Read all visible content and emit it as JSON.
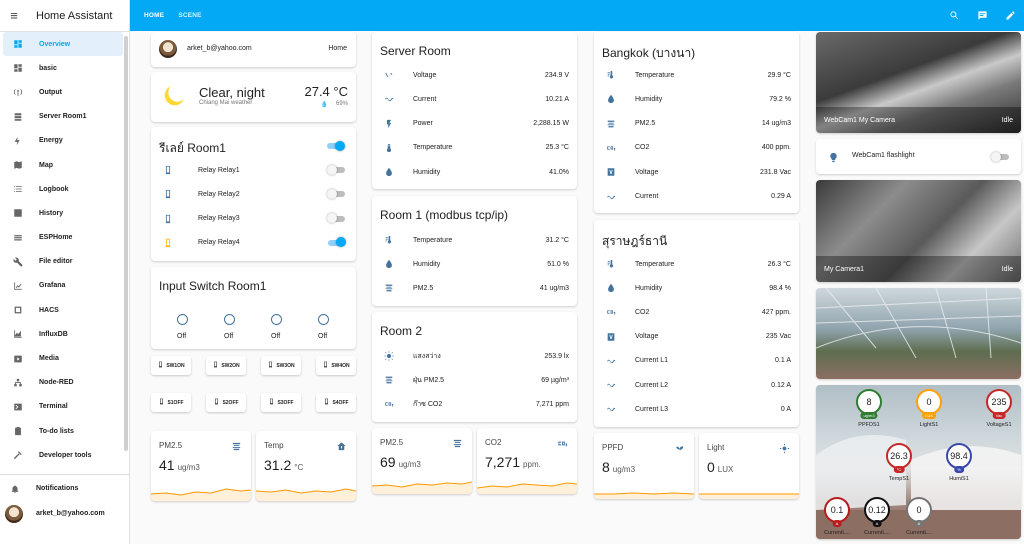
{
  "app": {
    "title": "Home Assistant"
  },
  "sidebar": {
    "items": [
      {
        "label": "Overview",
        "icon": "view-dashboard-icon",
        "active": true
      },
      {
        "label": "basic",
        "icon": "view-dashboard-icon"
      },
      {
        "label": "Output",
        "icon": "antenna-icon"
      },
      {
        "label": "Server Room1",
        "icon": "server-icon"
      },
      {
        "label": "Energy",
        "icon": "lightning-icon"
      },
      {
        "label": "Map",
        "icon": "map-icon"
      },
      {
        "label": "Logbook",
        "icon": "list-icon"
      },
      {
        "label": "History",
        "icon": "chart-bar-icon"
      },
      {
        "label": "ESPHome",
        "icon": "esphome-icon"
      },
      {
        "label": "File editor",
        "icon": "wrench-icon"
      },
      {
        "label": "Grafana",
        "icon": "chart-line-icon"
      },
      {
        "label": "HACS",
        "icon": "hacs-icon"
      },
      {
        "label": "InfluxDB",
        "icon": "chart-areaspline-icon"
      },
      {
        "label": "Media",
        "icon": "media-icon"
      },
      {
        "label": "Node-RED",
        "icon": "sitemap-icon"
      },
      {
        "label": "Terminal",
        "icon": "console-icon"
      },
      {
        "label": "To-do lists",
        "icon": "clipboard-icon"
      },
      {
        "label": "Developer tools",
        "icon": "hammer-icon"
      }
    ],
    "notifications": "Notifications",
    "user": "arket_b@yahoo.com"
  },
  "topbar": {
    "tabs": [
      "HOME",
      "SCENE"
    ]
  },
  "col1": {
    "profile": {
      "email": "arket_b@yahoo.com",
      "zone": "Home"
    },
    "weather": {
      "condition": "Clear, night",
      "location": "Chiang Mai weather",
      "temp": "27.4 °C",
      "humidity": "69%"
    },
    "relay": {
      "title": "รีเลย์ Room1",
      "items": [
        {
          "label": "Relay Relay1",
          "on": false
        },
        {
          "label": "Relay Relay2",
          "on": false
        },
        {
          "label": "Relay Relay3",
          "on": false
        },
        {
          "label": "Relay Relay4",
          "on": true
        }
      ]
    },
    "input": {
      "title": "Input Switch Room1",
      "states": [
        "Off",
        "Off",
        "Off",
        "Off"
      ]
    },
    "buttons_on": [
      "SW1ON",
      "SW2ON",
      "SW3ON",
      "SW4ON"
    ],
    "buttons_off": [
      "S1OFF",
      "S2OFF",
      "S3OFF",
      "S4OFF"
    ],
    "sensors": [
      {
        "name": "PM2.5",
        "value": "41",
        "unit": "ug/m3"
      },
      {
        "name": "Temp",
        "value": "31.2",
        "unit": "°C"
      }
    ]
  },
  "col2": {
    "server": {
      "title": "Server Room",
      "rows": [
        {
          "label": "Voltage",
          "value": "234.9 V",
          "icon": "sine-wave-icon"
        },
        {
          "label": "Current",
          "value": "10.21 A",
          "icon": "current-ac-icon"
        },
        {
          "label": "Power",
          "value": "2,288.15 W",
          "icon": "flash-icon"
        },
        {
          "label": "Temperature",
          "value": "25.3 °C",
          "icon": "thermometer-icon"
        },
        {
          "label": "Humidity",
          "value": "41.0%",
          "icon": "water-drop-icon"
        }
      ]
    },
    "room1": {
      "title": "Room 1 (modbus tcp/ip)",
      "rows": [
        {
          "label": "Temperature",
          "value": "31.2 °C",
          "icon": "thermometer-lines-icon"
        },
        {
          "label": "Humidity",
          "value": "51.0 %",
          "icon": "water-drop-icon"
        },
        {
          "label": "PM2.5",
          "value": "41 ug/m3",
          "icon": "air-filter-icon"
        }
      ]
    },
    "room2": {
      "title": "Room 2",
      "rows": [
        {
          "label": "แสงสว่าง",
          "value": "253.9 lx",
          "icon": "brightness-icon"
        },
        {
          "label": "ฝุ่น PM2.5",
          "value": "69 µg/m³",
          "icon": "air-filter-icon"
        },
        {
          "label": "ก๊าซ CO2",
          "value": "7,271 ppm",
          "icon": "molecule-co2-icon"
        }
      ]
    },
    "sensors": [
      {
        "name": "PM2.5",
        "value": "69",
        "unit": "ug/m3"
      },
      {
        "name": "CO2",
        "value": "7,271",
        "unit": "ppm."
      }
    ]
  },
  "col3": {
    "bangkok": {
      "title": "Bangkok (บางนา)",
      "rows": [
        {
          "label": "Temperature",
          "value": "29.9 °C",
          "icon": "thermometer-lines-icon"
        },
        {
          "label": "Humidity",
          "value": "79.2 %",
          "icon": "water-drop-icon"
        },
        {
          "label": "PM2.5",
          "value": "14 ug/m3",
          "icon": "air-filter-icon"
        },
        {
          "label": "CO2",
          "value": "400 ppm.",
          "icon": "molecule-co2-icon"
        },
        {
          "label": "Voltage",
          "value": "231.8 Vac",
          "icon": "alpha-v-box-icon"
        },
        {
          "label": "Current",
          "value": "0.29 A",
          "icon": "current-ac-icon"
        }
      ]
    },
    "surat": {
      "title": "สุราษฎร์ธานี",
      "rows": [
        {
          "label": "Temperature",
          "value": "26.3 °C",
          "icon": "thermometer-lines-icon"
        },
        {
          "label": "Humidity",
          "value": "98.4 %",
          "icon": "water-drop-icon"
        },
        {
          "label": "CO2",
          "value": "427 ppm.",
          "icon": "molecule-co2-icon"
        },
        {
          "label": "Voltage",
          "value": "235 Vac",
          "icon": "alpha-v-box-icon"
        },
        {
          "label": "Current L1",
          "value": "0.1 A",
          "icon": "current-ac-icon"
        },
        {
          "label": "Current L2",
          "value": "0.12 A",
          "icon": "current-ac-icon"
        },
        {
          "label": "Current L3",
          "value": "0 A",
          "icon": "current-ac-icon"
        }
      ]
    },
    "sensors": [
      {
        "name": "PPFD",
        "value": "8",
        "unit": "ug/m3"
      },
      {
        "name": "Light",
        "value": "0",
        "unit": "LUX"
      }
    ]
  },
  "col4": {
    "cam1": {
      "name": "WebCam1 My Camera",
      "state": "Idle"
    },
    "flash": {
      "label": "WebCam1 flashlight"
    },
    "cam2": {
      "name": "My Camera1",
      "state": "Idle"
    },
    "badges": [
      {
        "value": "8",
        "unit": "ug/m3",
        "label": "PPFDS1",
        "color": "#2e7d32"
      },
      {
        "value": "0",
        "unit": "LUX",
        "label": "LightS1",
        "color": "#ffa000"
      },
      {
        "value": "235",
        "unit": "Vac",
        "label": "VoltageS1",
        "color": "#c62828"
      },
      {
        "value": "26.3",
        "unit": "°C",
        "label": "TempS1",
        "color": "#c62828"
      },
      {
        "value": "98.4",
        "unit": "%",
        "label": "HumiS1",
        "color": "#3949ab"
      },
      {
        "value": "0.1",
        "unit": "A",
        "label": "CurrentL...",
        "color": "#b71c1c"
      },
      {
        "value": "0.12",
        "unit": "A",
        "label": "CurrentL...",
        "color": "#111111"
      },
      {
        "value": "0",
        "unit": "A",
        "label": "CurrentL...",
        "color": "#757575"
      }
    ]
  }
}
